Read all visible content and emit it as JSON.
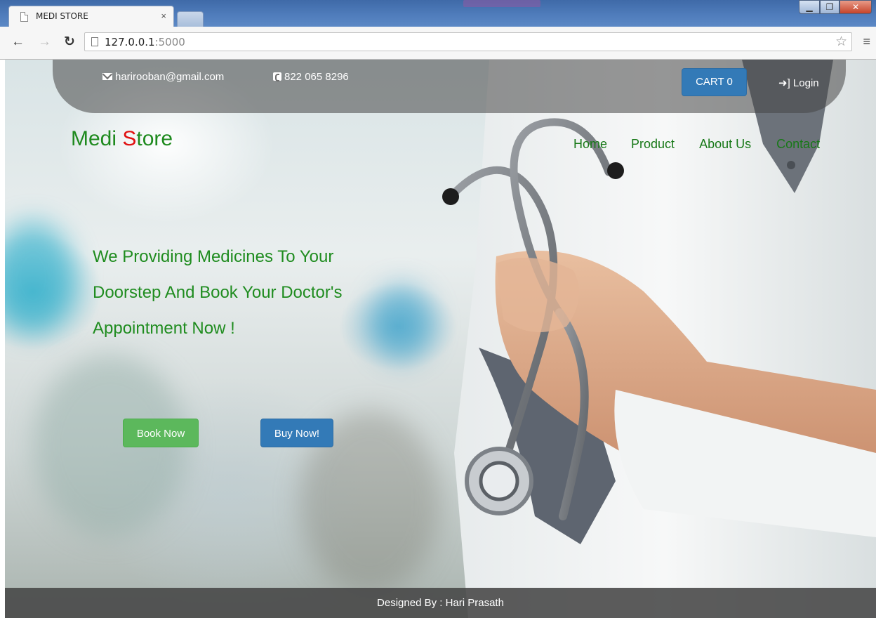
{
  "browser": {
    "tab_title": "MEDI STORE",
    "tab_close": "×",
    "url_host": "127.0.0.1",
    "url_port": ":5000",
    "window_controls": [
      "minimize-icon",
      "maximize-icon",
      "close-icon"
    ]
  },
  "topbar": {
    "email": "harirooban@gmail.com",
    "phone": "822 065 8296",
    "cart_label": "CART 0",
    "login_label": "Login"
  },
  "brand": {
    "name_first": "Medi ",
    "name_initial": "S",
    "name_rest": "tore"
  },
  "nav": {
    "items": [
      "Home",
      "Product",
      "About Us",
      "Contact"
    ]
  },
  "hero": {
    "lines": [
      "We Providing Medicines To Your",
      "Doorstep And Book Your Doctor's",
      "Appointment Now !"
    ],
    "book_button": "Book Now",
    "buy_button": "Buy Now!"
  },
  "footer": {
    "text": "Designed By : Hari Prasath"
  },
  "colors": {
    "brand_green": "#1e8a1e",
    "brand_red": "#e01010",
    "primary_blue": "#337ab7",
    "success_green": "#5cb85c"
  }
}
